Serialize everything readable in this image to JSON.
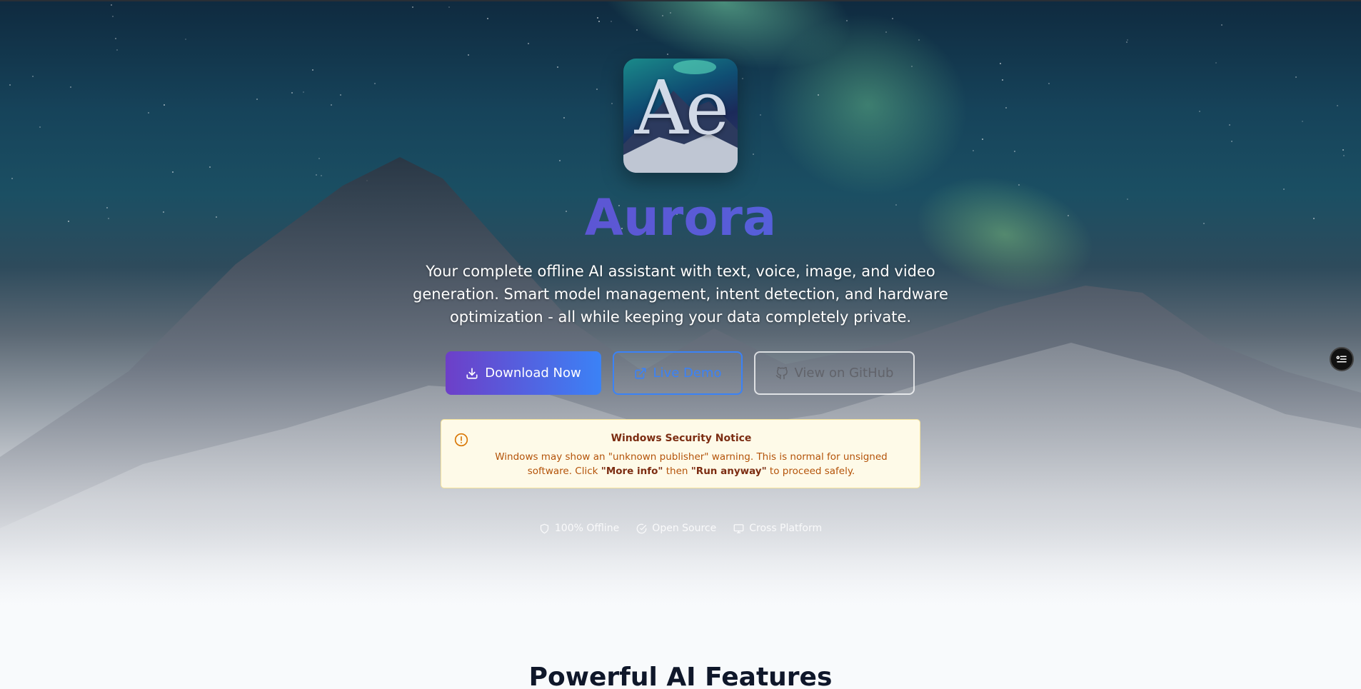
{
  "hero": {
    "logo_text": "Ae",
    "title": "Aurora",
    "subtitle": "Your complete offline AI assistant with text, voice, image, and video generation. Smart model management, intent detection, and hardware optimization - all while keeping your data completely private."
  },
  "buttons": {
    "download": "Download Now",
    "demo": "Live Demo",
    "github": "View on GitHub"
  },
  "notice": {
    "title": "Windows Security Notice",
    "body_prefix": "Windows may show an \"unknown publisher\" warning. This is normal for unsigned software. Click ",
    "more_info": "\"More info\"",
    "then": " then ",
    "run_anyway": "\"Run anyway\"",
    "suffix": " to proceed safely."
  },
  "badges": [
    {
      "icon": "shield-icon",
      "label": "100% Offline"
    },
    {
      "icon": "check-circle-icon",
      "label": "Open Source"
    },
    {
      "icon": "monitor-icon",
      "label": "Cross Platform"
    }
  ],
  "features": {
    "title": "Powerful AI Features"
  },
  "colors": {
    "gradient_start": "#6d3fc8",
    "gradient_end": "#3b82f6",
    "notice_bg": "#fefae8",
    "notice_text": "#b45309"
  }
}
